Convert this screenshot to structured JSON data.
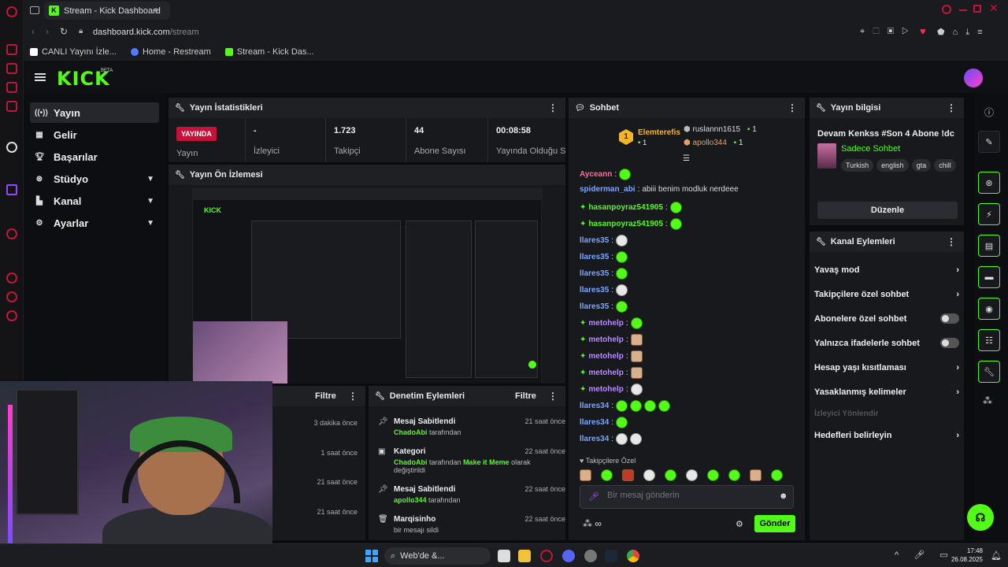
{
  "browser": {
    "tab_title": "Stream - Kick Dashboard",
    "url_host": "dashboard.kick.com",
    "url_path": "/stream",
    "bookmarks": [
      "CANLI Yayını İzle...",
      "Home - Restream",
      "Stream - Kick Das..."
    ]
  },
  "app": {
    "logo": "KICK",
    "beta": "BETA"
  },
  "nav": [
    {
      "label": "Yayın",
      "icon": "broadcast-icon"
    },
    {
      "label": "Gelir",
      "icon": "revenue-icon"
    },
    {
      "label": "Başarılar",
      "icon": "trophy-icon"
    },
    {
      "label": "Stüdyo",
      "icon": "studio-icon"
    },
    {
      "label": "Kanal",
      "icon": "channel-icon"
    },
    {
      "label": "Ayarlar",
      "icon": "settings-icon"
    }
  ],
  "stats": {
    "title": "Yayın İstatistikleri",
    "live": "YAYINDA",
    "cells": [
      {
        "value": "",
        "label": "Yayın"
      },
      {
        "value": "-",
        "label": "İzleyici"
      },
      {
        "value": "1.723",
        "label": "Takipçi"
      },
      {
        "value": "44",
        "label": "Abone Sayısı"
      },
      {
        "value": "00:08:58",
        "label": "Yayında Olduğu Süre"
      }
    ]
  },
  "preview": {
    "title": "Yayın Ön İzlemesi"
  },
  "chat": {
    "title": "Sohbet",
    "leader": {
      "rank": "1",
      "name": "Elemterefis",
      "count": "1"
    },
    "top2": {
      "name": "ruslannn1615",
      "count": "1"
    },
    "top3": {
      "name": "apollo344",
      "count": "1"
    },
    "messages": [
      {
        "user": "Ayceann",
        "color": "#ff6b9a",
        "text": "",
        "emotes": 1
      },
      {
        "user": "spiderman_abi",
        "color": "#7aa7ff",
        "text": "abiii benim modluk nerdeee",
        "emotes": 0
      },
      {
        "user": "hasanpoyraz541905",
        "color": "#53fc18",
        "text": "",
        "emotes": 1
      },
      {
        "user": "hasanpoyraz541905",
        "color": "#53fc18",
        "text": "",
        "emotes": 1
      },
      {
        "user": "llares35",
        "color": "#7aa7ff",
        "text": "",
        "emotes": 1
      },
      {
        "user": "llares35",
        "color": "#7aa7ff",
        "text": "",
        "emotes": 1
      },
      {
        "user": "llares35",
        "color": "#7aa7ff",
        "text": "",
        "emotes": 1
      },
      {
        "user": "llares35",
        "color": "#7aa7ff",
        "text": "",
        "emotes": 1
      },
      {
        "user": "llares35",
        "color": "#7aa7ff",
        "text": "",
        "emotes": 1
      },
      {
        "user": "metohelp",
        "color": "#b58cff",
        "text": "",
        "emotes": 1
      },
      {
        "user": "metohelp",
        "color": "#b58cff",
        "text": "",
        "emotes": 1
      },
      {
        "user": "metohelp",
        "color": "#b58cff",
        "text": "",
        "emotes": 1
      },
      {
        "user": "metohelp",
        "color": "#b58cff",
        "text": "",
        "emotes": 1
      },
      {
        "user": "metohelp",
        "color": "#b58cff",
        "text": "",
        "emotes": 1
      },
      {
        "user": "llares34",
        "color": "#7aa7ff",
        "text": "",
        "emotes": 4
      },
      {
        "user": "llares34",
        "color": "#7aa7ff",
        "text": "",
        "emotes": 1
      },
      {
        "user": "llares34",
        "color": "#7aa7ff",
        "text": "",
        "emotes": 2
      }
    ],
    "followers_only": "Takipçilere Özel",
    "input_placeholder": "Bir mesaj gönderin",
    "send": "Gönder"
  },
  "stream_info": {
    "title": "Yayın bilgisi",
    "stream_title": "Devam Kenkss #Son 4 Abone !dc",
    "category": "Sadece Sohbet",
    "tags": [
      "Turkish",
      "english",
      "gta",
      "chill"
    ],
    "edit": "Düzenle"
  },
  "channel_actions": {
    "title": "Kanal Eylemleri",
    "items": [
      {
        "label": "Yavaş mod",
        "kind": "chevron"
      },
      {
        "label": "Takipçilere özel sohbet",
        "kind": "chevron"
      },
      {
        "label": "Abonelere özel sohbet",
        "kind": "toggle"
      },
      {
        "label": "Yalnızca ifadelerle sohbet",
        "kind": "toggle"
      },
      {
        "label": "Hesap yaşı kısıtlaması",
        "kind": "chevron"
      },
      {
        "label": "Yasaklanmış kelimeler",
        "kind": "chevron"
      },
      {
        "label": "İzleyici Yönlendir",
        "kind": "disabled"
      },
      {
        "label": "Hedefleri belirleyin",
        "kind": "chevron"
      }
    ]
  },
  "activity": {
    "filter": "Filtre",
    "times": [
      "3 dakika önce",
      "1 saat önce",
      "21 saat önce",
      "21 saat önce"
    ]
  },
  "moderation": {
    "title": "Denetim Eylemleri",
    "filter": "Filtre",
    "events": [
      {
        "icon": "pin-icon",
        "title": "Mesaj Sabitlendi",
        "user": "ChadoAbi",
        "rest": "tarafından",
        "extra": "",
        "extra2": "",
        "time": "21 saat önce"
      },
      {
        "icon": "category-icon",
        "title": "Kategori",
        "user": "ChadoAbi",
        "rest": "tarafından",
        "extra": "Make it Meme",
        "extra2": "olarak değiştirildi",
        "time": "22 saat önce"
      },
      {
        "icon": "pin-icon",
        "title": "Mesaj Sabitlendi",
        "user": "apollo344",
        "rest": "tarafından",
        "extra": "",
        "extra2": "",
        "time": "22 saat önce"
      },
      {
        "icon": "trash-icon",
        "title": "Marqisinho",
        "user": "",
        "rest": "bir mesajı sildi",
        "extra": "",
        "extra2": "",
        "time": "22 saat önce"
      }
    ]
  },
  "taskbar": {
    "search": "Web'de &...",
    "time": "17:48",
    "date": "26.08.2025"
  },
  "colors": {
    "accent": "#53fc18",
    "live": "#c7113a",
    "bg": "#0b0c0e",
    "panel": "#18191c"
  }
}
